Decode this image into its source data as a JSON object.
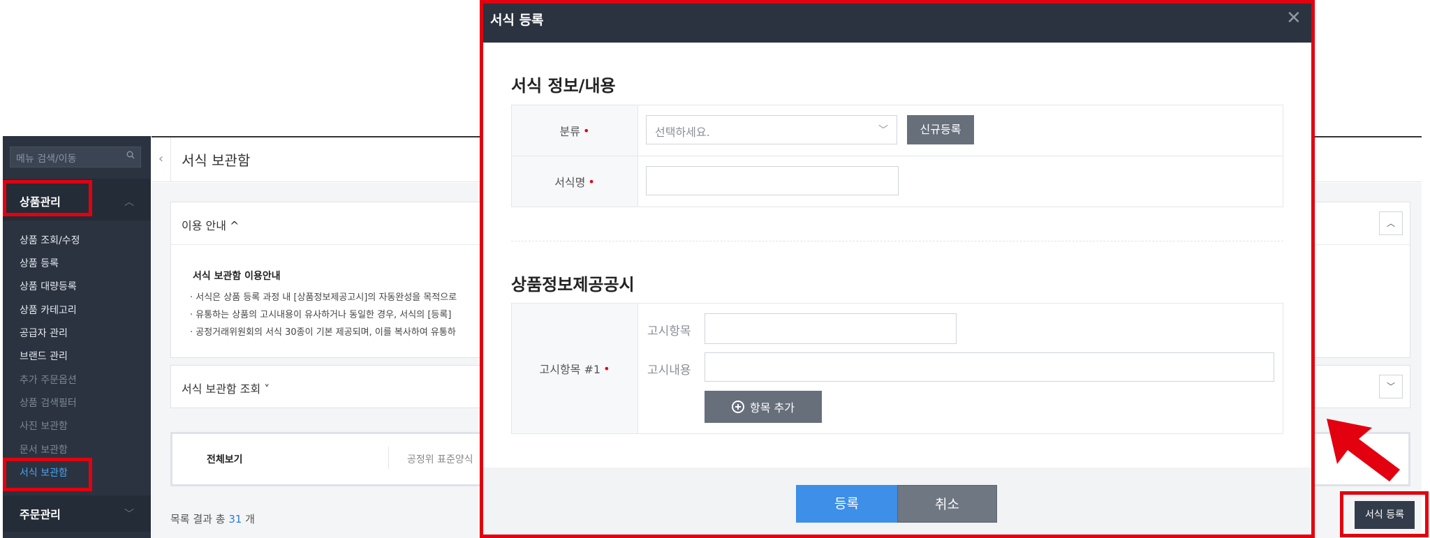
{
  "sidebar": {
    "search_placeholder": "메뉴 검색/이동",
    "group_product": "상품관리",
    "items": [
      {
        "label": "상품 조회/수정"
      },
      {
        "label": "상품 등록"
      },
      {
        "label": "상품 대량등록"
      },
      {
        "label": "상품 카테고리"
      },
      {
        "label": "공급자 관리"
      },
      {
        "label": "브랜드 관리"
      },
      {
        "label": "추가 주문옵션"
      },
      {
        "label": "상품 검색필터"
      },
      {
        "label": "사진 보관함"
      },
      {
        "label": "문서 보관함"
      },
      {
        "label": "서식 보관함"
      }
    ],
    "group_order": "주문관리"
  },
  "main": {
    "page_title": "서식 보관함",
    "guide": {
      "title": "이용 안내 ^",
      "heading": "서식 보관함 이용안내",
      "lines": [
        "· 서식은 상품 등록 과정 내 [상품정보제공고시]의 자동완성을 목적으로",
        "· 유통하는 상품의 고시내용이 유사하거나 동일한 경우, 서식의 [등록]",
        "· 공정거래위원회의 서식 30종이 기본 제공되며, 이를 복사하여 유통하"
      ]
    },
    "search_panel_title": "서식 보관함 조회 ˅",
    "tabs": {
      "all": "전체보기",
      "standard": "공정위 표준양식"
    },
    "result": {
      "prefix": "목록 결과 총 ",
      "count": "31",
      "suffix": " 개"
    },
    "register_button": "서식 등록"
  },
  "modal": {
    "title": "서식 등록",
    "close": "✕",
    "section1_title": "서식 정보/내용",
    "category_label": "분류",
    "category_placeholder": "선택하세요.",
    "new_register_button": "신규등록",
    "form_name_label": "서식명",
    "section2_title": "상품정보제공공시",
    "notice_item_label": "고시항목 #1",
    "notice_field_label": "고시항목",
    "notice_content_label": "고시내용",
    "add_item_button": "항목 추가",
    "submit_button": "등록",
    "cancel_button": "취소"
  },
  "colors": {
    "highlight": "#e3000f",
    "primary_blue": "#3d8fe8",
    "sidebar_bg": "#2b3340"
  }
}
